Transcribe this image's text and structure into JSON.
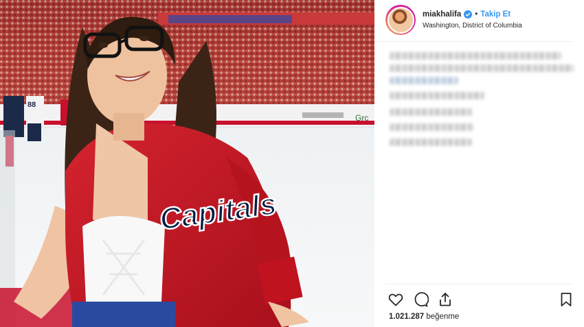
{
  "post": {
    "username": "miakhalifa",
    "dot": "•",
    "follow_label": "Takip Et",
    "location": "Washington, District of Columbia",
    "likes_count": "1.021.287",
    "likes_suffix": "beğenme"
  },
  "media": {
    "board_text": "Grc",
    "jersey_number": "88",
    "jacket_text": "Capitals"
  },
  "icons": {
    "like": "heart-icon",
    "comment": "comment-icon",
    "share": "share-icon",
    "save": "bookmark-icon",
    "verified": "verified-badge-icon"
  },
  "colors": {
    "accent": "#3897f0",
    "jacket_red": "#c8102e",
    "navy": "#041e42"
  }
}
